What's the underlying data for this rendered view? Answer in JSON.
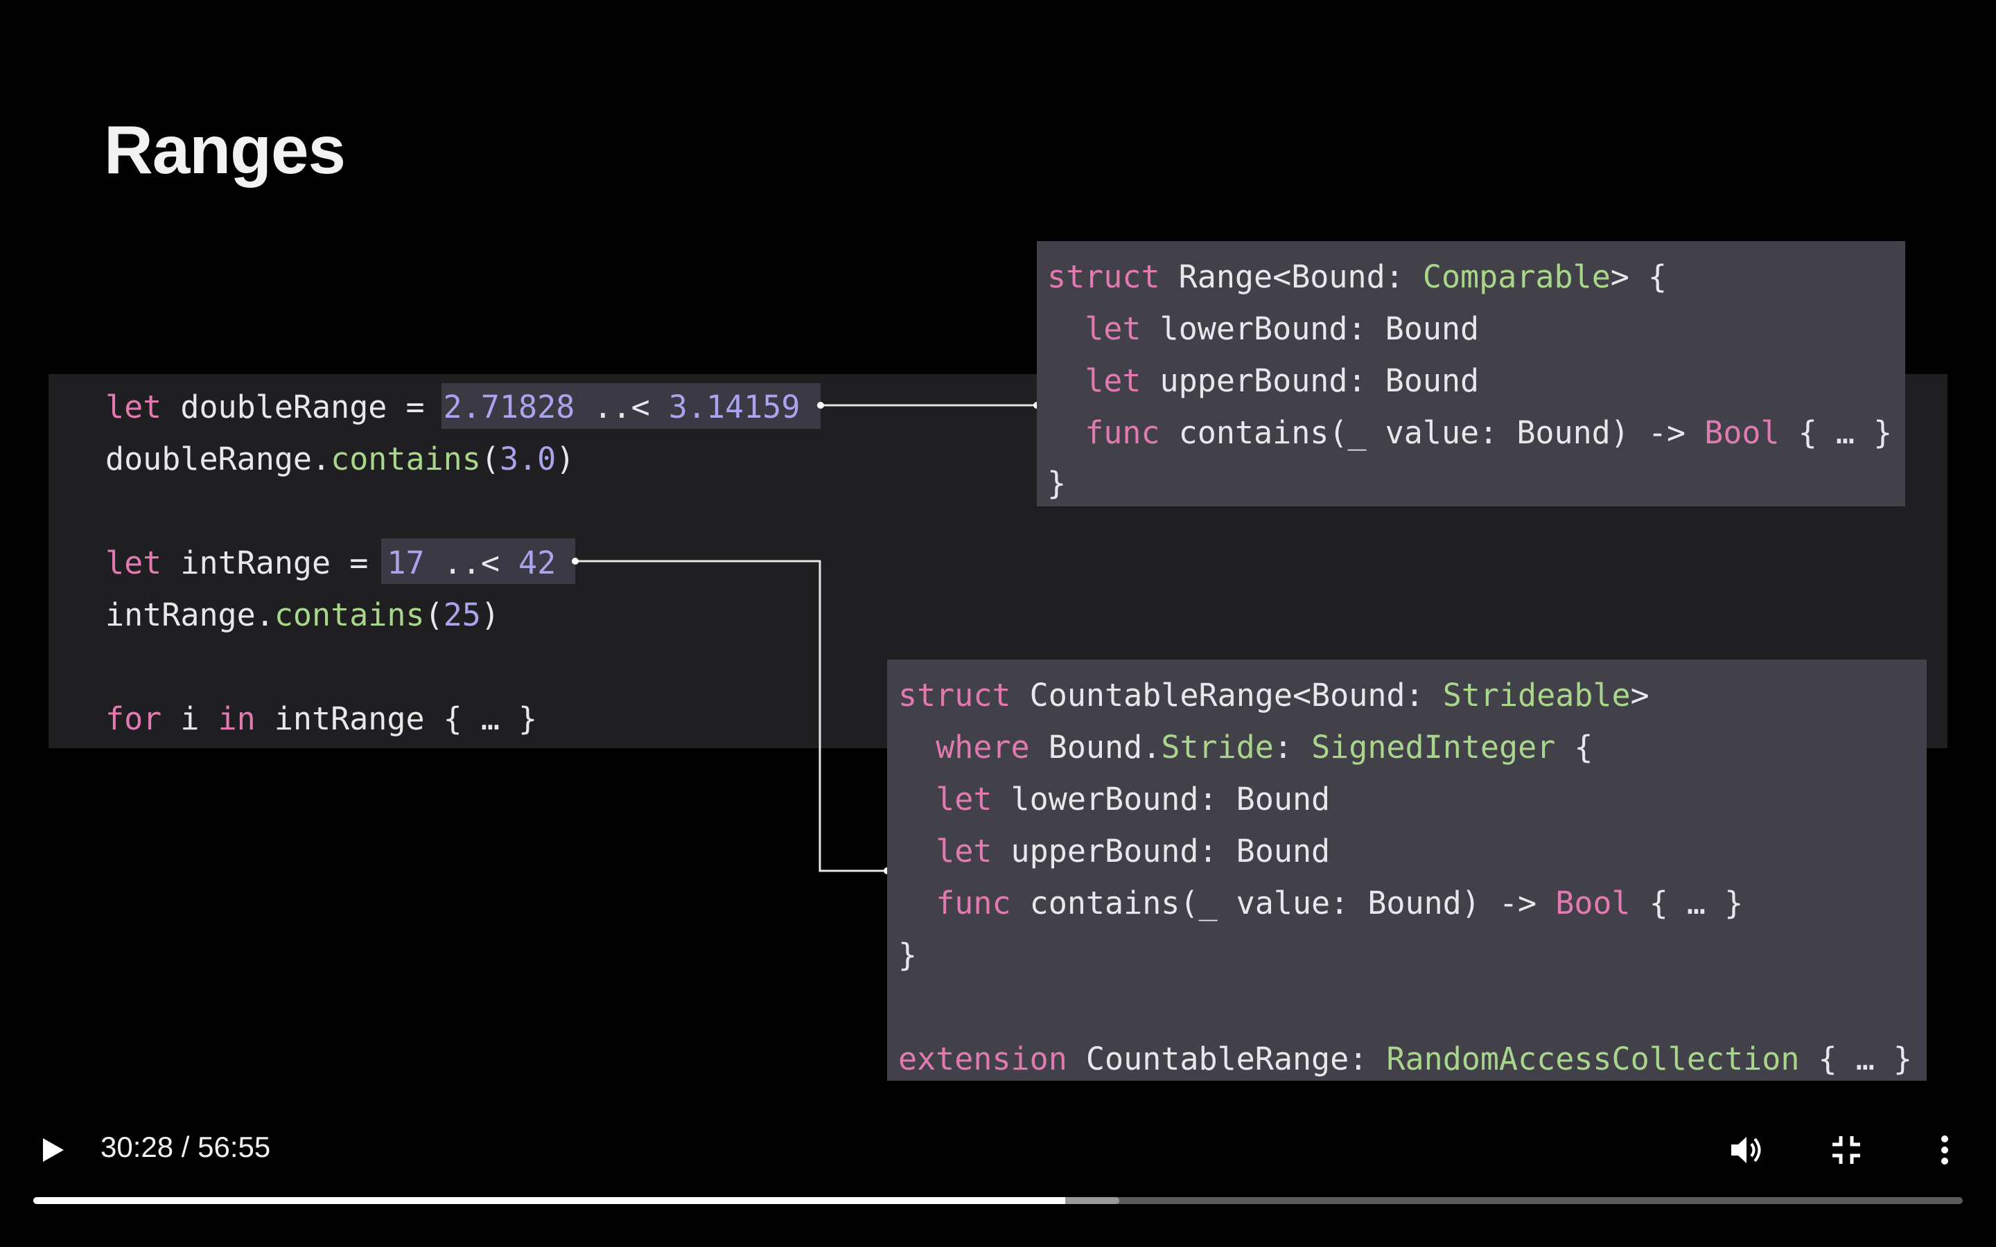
{
  "slide": {
    "title": "Ranges",
    "main_code": {
      "line1": {
        "kw": "let",
        "name": " doubleRange = ",
        "v1": "2.71828",
        "op": " ..< ",
        "v2": "3.14159"
      },
      "line2": {
        "obj": "doubleRange.",
        "method": "contains",
        "open": "(",
        "arg": "3.0",
        "close": ")"
      },
      "line3": {
        "kw": "let",
        "name": " intRange = ",
        "v1": "17",
        "op": " ..< ",
        "v2": "42"
      },
      "line4": {
        "obj": "intRange.",
        "method": "contains",
        "open": "(",
        "arg": "25",
        "close": ")"
      },
      "line5": {
        "kw1": "for",
        "mid1": " i ",
        "kw2": "in",
        "rest": " intRange { … }"
      }
    },
    "range_box": {
      "l1": {
        "kw": "struct",
        "name": " Range<Bound: ",
        "proto": "Comparable",
        "end": "> {"
      },
      "l2": {
        "kw": "let",
        "rest": " lowerBound: Bound"
      },
      "l3": {
        "kw": "let",
        "rest": " upperBound: Bound"
      },
      "l4": {
        "kw": "func",
        "rest": " contains(_ value: Bound) -> ",
        "ty": "Bool",
        "end": " { … }"
      },
      "l5": "}"
    },
    "countable_box": {
      "l1": {
        "kw": "struct",
        "name": " CountableRange<Bound: ",
        "proto": "Strideable",
        "end": ">"
      },
      "l2": {
        "kw": "where",
        "mid": " Bound.",
        "stride": "Stride",
        "colon": ": ",
        "proto": "SignedInteger",
        "end": " {"
      },
      "l3": {
        "kw": "let",
        "rest": " lowerBound: Bound"
      },
      "l4": {
        "kw": "let",
        "rest": " upperBound: Bound"
      },
      "l5": {
        "kw": "func",
        "rest": " contains(_ value: Bound) -> ",
        "ty": "Bool",
        "end": " { … }"
      },
      "l6": "}",
      "l7": {
        "kw": "extension",
        "name": " CountableRange: ",
        "proto": "RandomAccessCollection",
        "end": " { … }"
      }
    },
    "colors": {
      "keyword": "#e07ab0",
      "function": "#a9d68a",
      "number": "#a9a4ec",
      "background": "#000000"
    }
  },
  "player": {
    "current_time": "30:28",
    "separator": " / ",
    "duration": "56:55",
    "progress_fraction": 0.535,
    "buffered_fraction": 0.563,
    "icons": [
      "play-icon",
      "volume-icon",
      "exit-fullscreen-icon",
      "more-options-icon"
    ]
  }
}
